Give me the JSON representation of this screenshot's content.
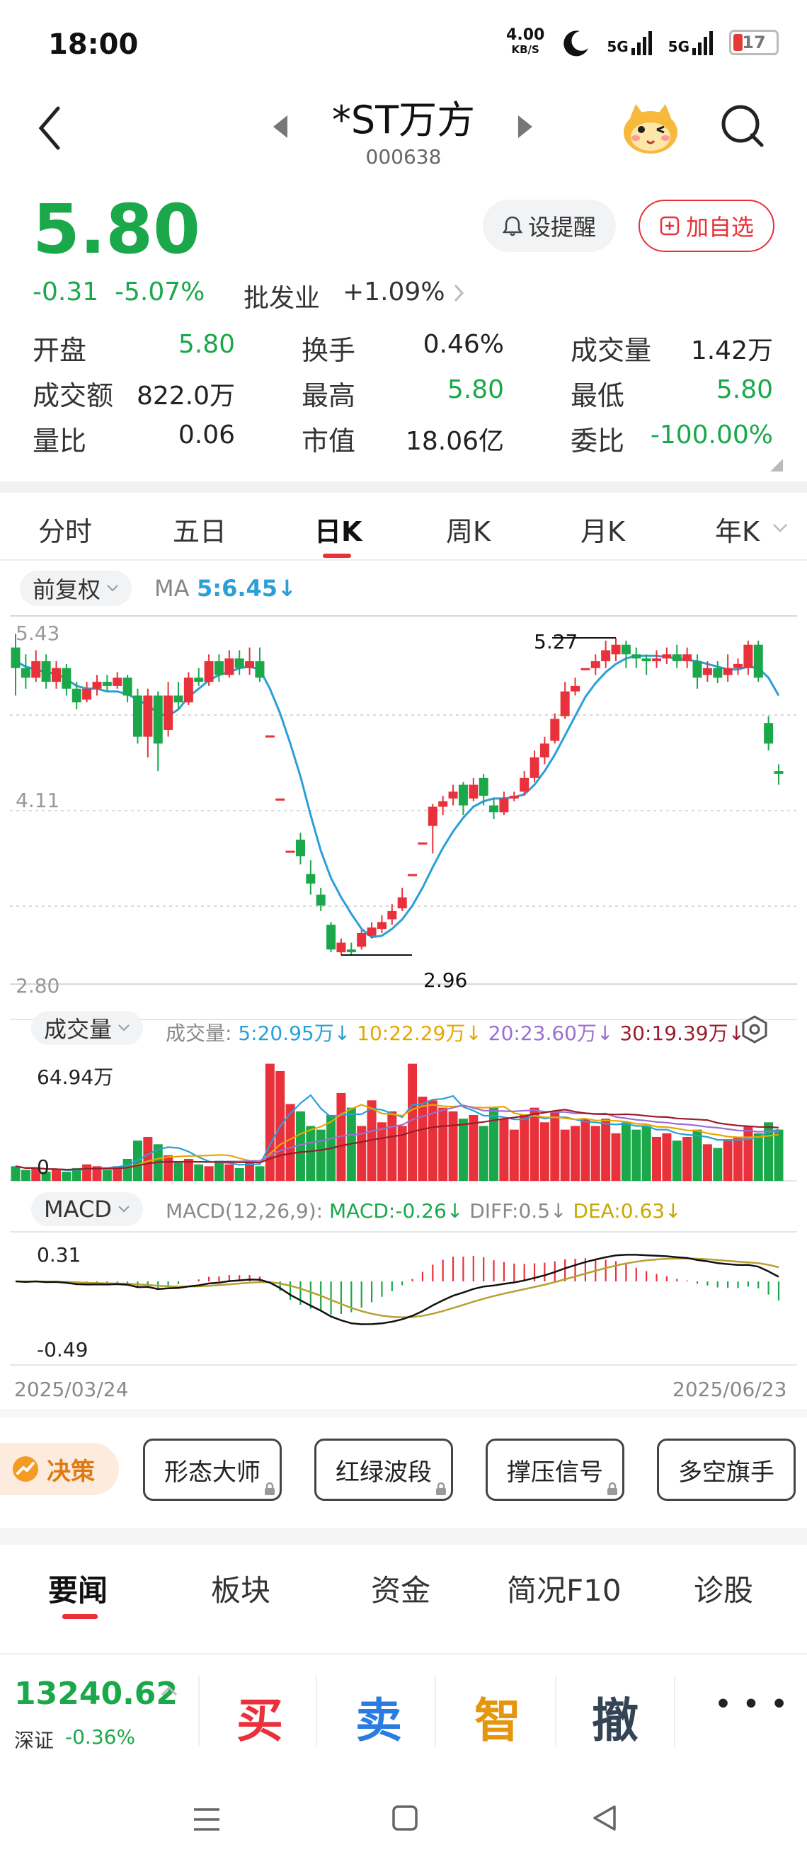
{
  "status_bar": {
    "time": "18:00",
    "speed": "4.00",
    "speed_unit": "KB/S",
    "net1": "5G",
    "net2": "5G",
    "battery": "17"
  },
  "header": {
    "title": "*ST万方",
    "code": "000638"
  },
  "quote": {
    "price": "5.80",
    "change": "-0.31",
    "change_pct": "-5.07%",
    "sector_label": "批发业",
    "sector_pct": "+1.09%",
    "alert_label": "设提醒",
    "watch_label": "加自选"
  },
  "stats": [
    {
      "label": "开盘",
      "value": "5.80",
      "color": "#1aa84a"
    },
    {
      "label": "换手",
      "value": "0.46%",
      "color": "#222222"
    },
    {
      "label": "成交量",
      "value": "1.42万",
      "color": "#222222"
    },
    {
      "label": "成交额",
      "value": "822.0万",
      "color": "#222222"
    },
    {
      "label": "最高",
      "value": "5.80",
      "color": "#1aa84a"
    },
    {
      "label": "最低",
      "value": "5.80",
      "color": "#1aa84a"
    },
    {
      "label": "量比",
      "value": "0.06",
      "color": "#222222"
    },
    {
      "label": "市值",
      "value": "18.06亿",
      "color": "#222222"
    },
    {
      "label": "委比",
      "value": "-100.00%",
      "color": "#1aa84a"
    }
  ],
  "tabs": [
    "分时",
    "五日",
    "日K",
    "周K",
    "月K",
    "年K"
  ],
  "active_tab": "日K",
  "kline": {
    "adjust_label": "前复权",
    "ma_label": "MA",
    "ma_value": "5:6.45",
    "y_top": "5.43",
    "y_mid": "4.11",
    "y_bottom": "2.80",
    "high_label": "5.27",
    "low_label": "2.96"
  },
  "volume": {
    "selector_label": "成交量",
    "legend_prefix": "成交量:",
    "ma5": "5:20.95万",
    "ma10": "10:22.29万",
    "ma20": "20:23.60万",
    "ma30": "30:19.39万",
    "y_top": "64.94万",
    "y_zero": "0"
  },
  "macd": {
    "selector_label": "MACD",
    "params": "MACD(12,26,9):",
    "macd": "MACD:-0.26",
    "diff": "DIFF:0.5",
    "dea": "DEA:0.63",
    "y_top": "0.31",
    "y_bottom": "-0.49",
    "date_start": "2025/03/24",
    "date_end": "2025/06/23"
  },
  "features": {
    "badge": "决策",
    "items": [
      "形态大师",
      "红绿波段",
      "撑压信号",
      "多空旗手"
    ]
  },
  "news_tabs": [
    "要闻",
    "板块",
    "资金",
    "简况F10",
    "诊股"
  ],
  "bottom": {
    "index_value": "13240.62",
    "index_name": "深证",
    "index_pct": "-0.36%",
    "buy": "买",
    "sell": "卖",
    "smart": "智",
    "cancel": "撤",
    "more": "• • •"
  },
  "colors": {
    "up": "#e8313a",
    "down": "#1aa84a",
    "ma": "#2a9fd8",
    "dea": "#b8a032",
    "diff": "#111111"
  },
  "chart_data": {
    "type": "candlestick",
    "x_start": "2025/03/24",
    "x_end": "2025/06/23",
    "ylim": [
      2.8,
      5.43
    ],
    "candles": [
      [
        5.2,
        5.05,
        5.3,
        4.85
      ],
      [
        5.05,
        4.98,
        5.15,
        4.9
      ],
      [
        4.98,
        5.1,
        5.18,
        4.95
      ],
      [
        5.1,
        4.95,
        5.15,
        4.9
      ],
      [
        4.95,
        5.05,
        5.1,
        4.9
      ],
      [
        5.05,
        4.9,
        5.08,
        4.85
      ],
      [
        4.9,
        4.8,
        4.95,
        4.75
      ],
      [
        4.82,
        4.9,
        4.95,
        4.8
      ],
      [
        4.9,
        4.95,
        5.0,
        4.85
      ],
      [
        4.95,
        4.92,
        5.0,
        4.88
      ],
      [
        4.92,
        4.98,
        5.02,
        4.9
      ],
      [
        4.98,
        4.85,
        5.0,
        4.8
      ],
      [
        4.85,
        4.55,
        4.9,
        4.5
      ],
      [
        4.55,
        4.85,
        4.9,
        4.4
      ],
      [
        4.85,
        4.5,
        4.88,
        4.3
      ],
      [
        4.6,
        4.85,
        4.95,
        4.55
      ],
      [
        4.85,
        4.8,
        4.95,
        4.75
      ],
      [
        4.8,
        4.98,
        5.02,
        4.78
      ],
      [
        4.98,
        4.95,
        5.05,
        4.92
      ],
      [
        4.95,
        5.1,
        5.15,
        4.92
      ],
      [
        5.1,
        5.0,
        5.15,
        4.95
      ],
      [
        5.0,
        5.12,
        5.18,
        4.98
      ],
      [
        5.12,
        5.05,
        5.18,
        5.0
      ],
      [
        5.05,
        5.1,
        5.2,
        5.0
      ],
      [
        5.1,
        4.98,
        5.2,
        4.95
      ],
      [
        4.56,
        4.56,
        4.56,
        4.56
      ],
      [
        4.1,
        4.1,
        4.1,
        4.1
      ],
      [
        3.72,
        3.72,
        3.72,
        3.72
      ],
      [
        3.8,
        3.68,
        3.85,
        3.62
      ],
      [
        3.55,
        3.48,
        3.65,
        3.4
      ],
      [
        3.4,
        3.32,
        3.45,
        3.28
      ],
      [
        3.18,
        3.0,
        3.2,
        2.98
      ],
      [
        2.98,
        3.05,
        3.08,
        2.96
      ],
      [
        3.0,
        2.98,
        3.05,
        2.96
      ],
      [
        3.02,
        3.12,
        3.14,
        3.0
      ],
      [
        3.1,
        3.16,
        3.2,
        3.08
      ],
      [
        3.15,
        3.2,
        3.25,
        3.12
      ],
      [
        3.22,
        3.28,
        3.33,
        3.18
      ],
      [
        3.3,
        3.38,
        3.45,
        3.28
      ],
      [
        3.55,
        3.55,
        3.55,
        3.55
      ],
      [
        3.78,
        3.78,
        3.78,
        3.78
      ],
      [
        3.9,
        4.04,
        4.06,
        3.7
      ],
      [
        4.04,
        4.08,
        4.12,
        3.98
      ],
      [
        4.1,
        4.15,
        4.2,
        4.05
      ],
      [
        4.2,
        4.05,
        4.22,
        3.98
      ],
      [
        4.1,
        4.2,
        4.25,
        4.08
      ],
      [
        4.25,
        4.12,
        4.28,
        4.05
      ],
      [
        4.05,
        4.0,
        4.1,
        3.95
      ],
      [
        4.0,
        4.1,
        4.15,
        3.98
      ],
      [
        4.1,
        4.12,
        4.15,
        4.08
      ],
      [
        4.15,
        4.25,
        4.3,
        4.12
      ],
      [
        4.25,
        4.4,
        4.45,
        4.22
      ],
      [
        4.4,
        4.5,
        4.55,
        4.35
      ],
      [
        4.52,
        4.68,
        4.72,
        4.5
      ],
      [
        4.7,
        4.88,
        4.95,
        4.68
      ],
      [
        4.88,
        4.92,
        4.98,
        4.85
      ],
      [
        5.05,
        5.05,
        5.05,
        5.05
      ],
      [
        5.05,
        5.1,
        5.15,
        5.0
      ],
      [
        5.1,
        5.18,
        5.25,
        5.05
      ],
      [
        5.15,
        5.22,
        5.27,
        5.1
      ],
      [
        5.22,
        5.15,
        5.25,
        5.05
      ],
      [
        5.15,
        5.12,
        5.2,
        5.05
      ],
      [
        5.12,
        5.1,
        5.15,
        5.0
      ],
      [
        5.1,
        5.12,
        5.18,
        5.05
      ],
      [
        5.12,
        5.15,
        5.2,
        5.08
      ],
      [
        5.15,
        5.1,
        5.22,
        5.05
      ],
      [
        5.1,
        5.15,
        5.2,
        5.05
      ],
      [
        5.1,
        4.98,
        5.15,
        4.9
      ],
      [
        5.0,
        5.05,
        5.1,
        4.95
      ],
      [
        5.05,
        4.98,
        5.1,
        4.94
      ],
      [
        5.0,
        5.05,
        5.15,
        4.95
      ],
      [
        5.05,
        5.08,
        5.12,
        5.0
      ],
      [
        5.05,
        5.22,
        5.25,
        5.0
      ],
      [
        5.22,
        4.98,
        5.25,
        4.95
      ],
      [
        4.65,
        4.5,
        4.7,
        4.45
      ],
      [
        4.3,
        4.28,
        4.35,
        4.2
      ]
    ],
    "ma5": [
      5.1,
      5.06,
      5.04,
      5.02,
      5.01,
      4.97,
      4.92,
      4.9,
      4.9,
      4.88,
      4.88,
      4.86,
      4.82,
      4.78,
      4.72,
      4.7,
      4.75,
      4.84,
      4.9,
      4.96,
      5.0,
      5.02,
      5.05,
      5.06,
      5.04,
      4.9,
      4.72,
      4.5,
      4.26,
      3.98,
      3.72,
      3.52,
      3.38,
      3.26,
      3.15,
      3.09,
      3.1,
      3.15,
      3.22,
      3.32,
      3.45,
      3.6,
      3.74,
      3.86,
      3.96,
      4.04,
      4.08,
      4.1,
      4.1,
      4.11,
      4.13,
      4.2,
      4.3,
      4.42,
      4.56,
      4.7,
      4.84,
      4.94,
      5.02,
      5.08,
      5.12,
      5.14,
      5.14,
      5.14,
      5.13,
      5.12,
      5.11,
      5.1,
      5.08,
      5.06,
      5.04,
      5.04,
      5.06,
      5.05,
      4.98,
      4.85
    ]
  }
}
